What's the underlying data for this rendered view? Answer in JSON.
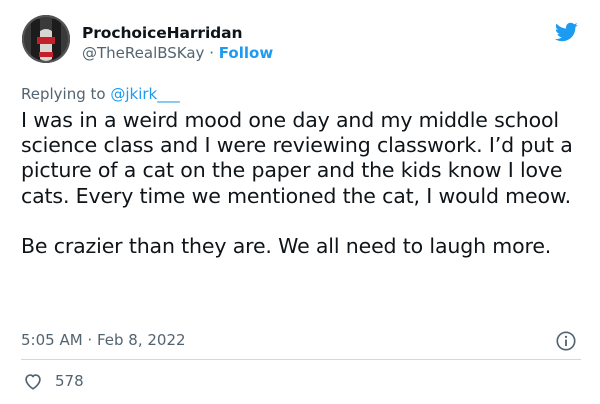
{
  "tweet": {
    "author": {
      "display_name": "ProchoiceHarridan",
      "handle": "@TheRealBSKay",
      "separator": "·",
      "follow_label": "Follow"
    },
    "brand_icon": "twitter-bird-icon",
    "reply": {
      "prefix": "Replying to",
      "mention": "@jkirk___"
    },
    "paragraphs": [
      "I was in a weird mood one day and my middle school science class and I were reviewing classwork.  I’d put a picture of a cat on the paper and the kids know I love cats.  Every time we mentioned the cat, I would meow.",
      "Be crazier than they are.  We all need to laugh more."
    ],
    "timestamp": "5:05 AM · Feb 8, 2022",
    "like_count": "578",
    "icons": {
      "info": "info-icon",
      "like": "heart-icon"
    }
  },
  "colors": {
    "accent": "#1d9bf0",
    "text": "#0f1419",
    "muted": "#536471",
    "divider": "#cfd9de"
  }
}
